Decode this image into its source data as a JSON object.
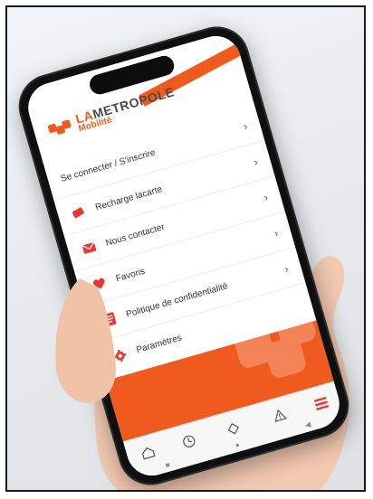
{
  "brand": {
    "logo_la": "LA",
    "logo_metropole": "METROPOLE",
    "logo_sub": "Mobilité"
  },
  "menu": {
    "items": [
      {
        "label": "Se connecter / S'inscrire",
        "icon": "none"
      },
      {
        "label": "Recharge lacarte",
        "icon": "card-icon"
      },
      {
        "label": "Nous contacter",
        "icon": "mail-icon"
      },
      {
        "label": "Favoris",
        "icon": "heart-icon"
      },
      {
        "label": "Politique de confidentialité",
        "icon": "document-icon"
      },
      {
        "label": "Paramètres",
        "icon": "gear-icon"
      }
    ],
    "chevron": "›"
  },
  "tabs": [
    {
      "label": "Accueil",
      "icon": "home-icon"
    },
    {
      "label": "Horaires",
      "icon": "clock-icon"
    },
    {
      "label": "Mes titres",
      "icon": "ticket-icon"
    },
    {
      "label": "Infos trafic",
      "icon": "warning-icon"
    },
    {
      "label": "Menu",
      "icon": "menu-icon",
      "active": true
    }
  ],
  "navbar": {
    "back": "◀",
    "home": "●",
    "recent": "■"
  },
  "colors": {
    "accent": "#ef5a1f",
    "menu_active": "#e53935"
  }
}
